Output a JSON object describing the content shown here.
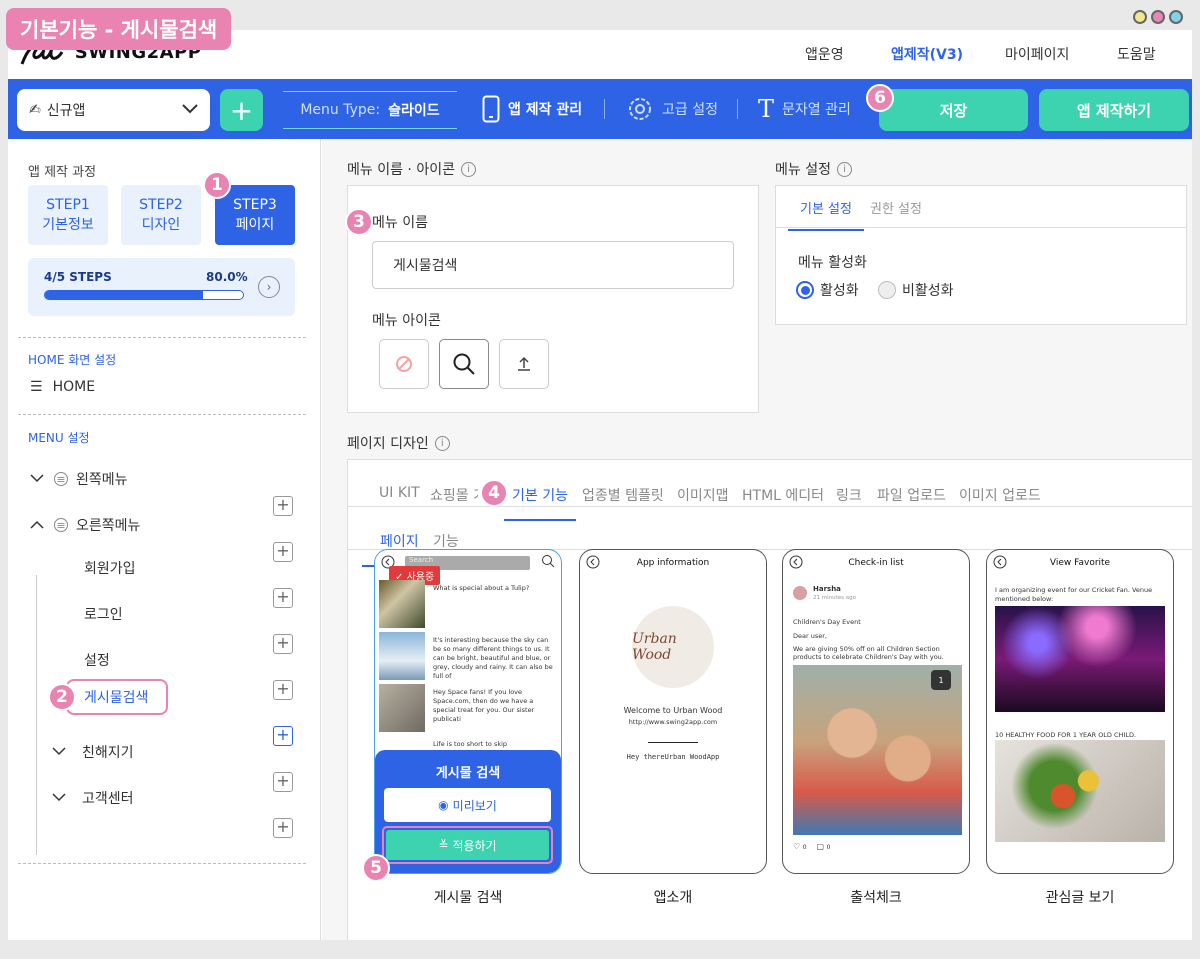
{
  "window_title": "기본기능 - 게시물검색",
  "top_nav": {
    "logo": "SWING2APP",
    "items": [
      "앱운영",
      "앱제작(V3)",
      "마이페이지",
      "도움말"
    ]
  },
  "toolbar": {
    "app_select": "신규앱",
    "add": "+",
    "menu_type_label": "Menu Type:",
    "menu_type_value": "슬라이드",
    "app_manage": "앱 제작 관리",
    "advanced": "고급 설정",
    "strings": "문자열 관리",
    "save": "저장",
    "build": "앱 제작하기"
  },
  "sidebar": {
    "process_title": "앱 제작 과정",
    "steps": [
      {
        "line1": "STEP1",
        "line2": "기본정보"
      },
      {
        "line1": "STEP2",
        "line2": "디자인"
      },
      {
        "line1": "STEP3",
        "line2": "페이지"
      }
    ],
    "progress_label": "4/5 STEPS",
    "progress_percent": "80.0%",
    "progress_value": 0.8,
    "home_section": "HOME 화면 설정",
    "home_item": "HOME",
    "menu_section": "MENU 설정",
    "menus": {
      "left": "왼쪽메뉴",
      "right": "오른쪽메뉴",
      "signup": "회원가입",
      "login": "로그인",
      "settings": "설정",
      "search": "게시물검색",
      "friends": "친해지기",
      "support": "고객센터"
    }
  },
  "menu_name_panel": {
    "title": "메뉴 이름 · 아이콘",
    "name_label": "메뉴 이름",
    "name_value": "게시물검색",
    "icon_label": "메뉴 아이콘"
  },
  "menu_settings_panel": {
    "title": "메뉴 설정",
    "tabs": [
      "기본 설정",
      "권한 설정"
    ],
    "activation_label": "메뉴 활성화",
    "options": [
      "활성화",
      "비활성화"
    ]
  },
  "page_design": {
    "title": "페이지 디자인",
    "tabs": [
      "UI KIT",
      "쇼핑몰 기",
      "기본 기능",
      "업종별 템플릿",
      "이미지맵",
      "HTML 에디터",
      "링크",
      "파일 업로드",
      "이미지 업로드"
    ],
    "subtabs": [
      "페이지",
      "기능"
    ]
  },
  "templates": [
    {
      "caption": "게시물 검색",
      "in_use": "사용중",
      "search_placeholder": "Search",
      "posts": [
        "What is special about a Tulip?",
        "It's interesting because the sky can be so many different things to us. It can be bright, beautiful and blue, or grey, cloudy and rainy. It can also be full of",
        "Hey Space fans! If you love Space.com, then do we have a special treat for you. Our sister publicati",
        "Life is too short to skip"
      ],
      "overlay_title": "게시물 검색",
      "preview": "미리보기",
      "apply": "적용하기"
    },
    {
      "caption": "앱소개",
      "header": "App information",
      "logo_text": "Urban Wood",
      "welcome": "Welcome to Urban Wood",
      "url": "http://www.swing2app.com",
      "greeting": "Hey thereUrban WoodApp"
    },
    {
      "caption": "출석체크",
      "header": "Check-in list",
      "user": "Harsha",
      "time": "21 minutes ago",
      "event_title": "Children's Day Event",
      "dear": "Dear user,",
      "body": "We are giving 50% off on all Children Section products to celebrate Children's Day with you.",
      "img_count": "1",
      "likes": "0",
      "comments": "0"
    },
    {
      "caption": "관심글 보기",
      "header": "View Favorite",
      "text1": "I am organizing event for our Cricket Fan. Venue mentioned below:",
      "text2": "10 HEALTHY FOOD FOR 1 YEAR OLD CHILD."
    }
  ],
  "badges": [
    "1",
    "2",
    "3",
    "4",
    "5",
    "6"
  ],
  "colors": {
    "primary": "#2d63e4",
    "accent": "#3dd3b0",
    "badge": "#e983b2"
  }
}
